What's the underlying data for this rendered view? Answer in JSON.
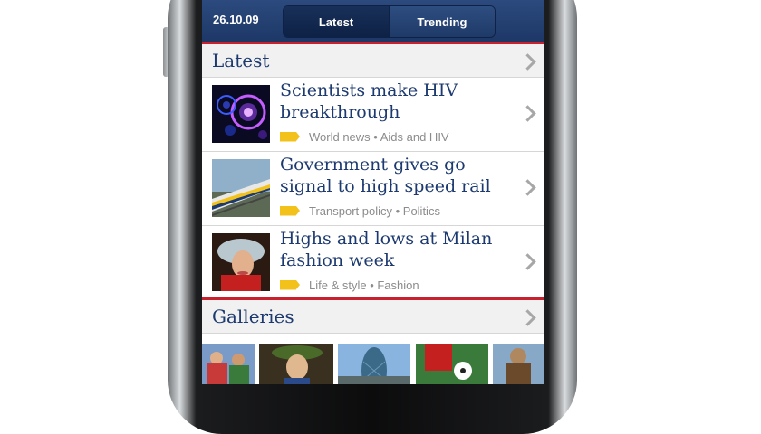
{
  "header": {
    "date": "26.10.09",
    "tabs": [
      {
        "label": "Latest",
        "active": true
      },
      {
        "label": "Trending",
        "active": false
      }
    ]
  },
  "latest": {
    "title": "Latest",
    "stories": [
      {
        "headline": "Scientists make HIV breakthrough",
        "tags": "World news • Aids and HIV",
        "image": "hiv-virus-image"
      },
      {
        "headline": "Government gives go signal to high speed rail",
        "tags": "Transport policy • Politics",
        "image": "high-speed-train-image"
      },
      {
        "headline": "Highs and lows at Milan fashion week",
        "tags": "Life & style • Fashion",
        "image": "fashion-model-image"
      }
    ]
  },
  "galleries": {
    "title": "Galleries",
    "images": [
      "gallery-people-image",
      "gallery-soldier-image",
      "gallery-building-image",
      "gallery-football-image",
      "gallery-figure-image"
    ]
  },
  "colors": {
    "header_blue": "#1d3867",
    "title_blue": "#1d3a70",
    "accent_red": "#c8202c",
    "tag_yellow": "#f2c21b"
  }
}
